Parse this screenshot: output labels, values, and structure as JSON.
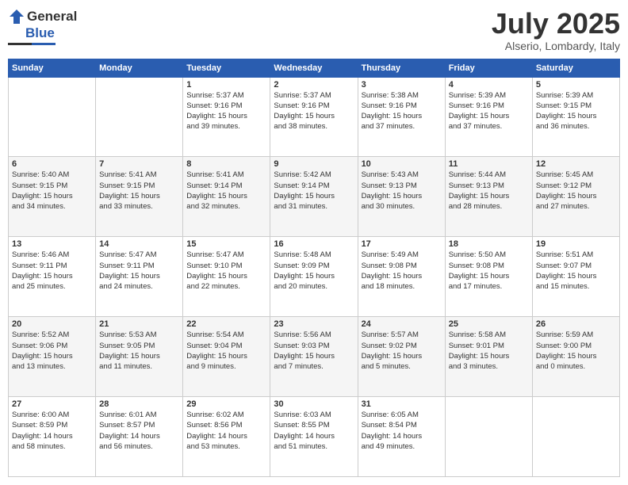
{
  "logo": {
    "general": "General",
    "blue": "Blue"
  },
  "title": "July 2025",
  "location": "Alserio, Lombardy, Italy",
  "headers": [
    "Sunday",
    "Monday",
    "Tuesday",
    "Wednesday",
    "Thursday",
    "Friday",
    "Saturday"
  ],
  "weeks": [
    [
      {
        "day": "",
        "info": ""
      },
      {
        "day": "",
        "info": ""
      },
      {
        "day": "1",
        "info": "Sunrise: 5:37 AM\nSunset: 9:16 PM\nDaylight: 15 hours\nand 39 minutes."
      },
      {
        "day": "2",
        "info": "Sunrise: 5:37 AM\nSunset: 9:16 PM\nDaylight: 15 hours\nand 38 minutes."
      },
      {
        "day": "3",
        "info": "Sunrise: 5:38 AM\nSunset: 9:16 PM\nDaylight: 15 hours\nand 37 minutes."
      },
      {
        "day": "4",
        "info": "Sunrise: 5:39 AM\nSunset: 9:16 PM\nDaylight: 15 hours\nand 37 minutes."
      },
      {
        "day": "5",
        "info": "Sunrise: 5:39 AM\nSunset: 9:15 PM\nDaylight: 15 hours\nand 36 minutes."
      }
    ],
    [
      {
        "day": "6",
        "info": "Sunrise: 5:40 AM\nSunset: 9:15 PM\nDaylight: 15 hours\nand 34 minutes."
      },
      {
        "day": "7",
        "info": "Sunrise: 5:41 AM\nSunset: 9:15 PM\nDaylight: 15 hours\nand 33 minutes."
      },
      {
        "day": "8",
        "info": "Sunrise: 5:41 AM\nSunset: 9:14 PM\nDaylight: 15 hours\nand 32 minutes."
      },
      {
        "day": "9",
        "info": "Sunrise: 5:42 AM\nSunset: 9:14 PM\nDaylight: 15 hours\nand 31 minutes."
      },
      {
        "day": "10",
        "info": "Sunrise: 5:43 AM\nSunset: 9:13 PM\nDaylight: 15 hours\nand 30 minutes."
      },
      {
        "day": "11",
        "info": "Sunrise: 5:44 AM\nSunset: 9:13 PM\nDaylight: 15 hours\nand 28 minutes."
      },
      {
        "day": "12",
        "info": "Sunrise: 5:45 AM\nSunset: 9:12 PM\nDaylight: 15 hours\nand 27 minutes."
      }
    ],
    [
      {
        "day": "13",
        "info": "Sunrise: 5:46 AM\nSunset: 9:11 PM\nDaylight: 15 hours\nand 25 minutes."
      },
      {
        "day": "14",
        "info": "Sunrise: 5:47 AM\nSunset: 9:11 PM\nDaylight: 15 hours\nand 24 minutes."
      },
      {
        "day": "15",
        "info": "Sunrise: 5:47 AM\nSunset: 9:10 PM\nDaylight: 15 hours\nand 22 minutes."
      },
      {
        "day": "16",
        "info": "Sunrise: 5:48 AM\nSunset: 9:09 PM\nDaylight: 15 hours\nand 20 minutes."
      },
      {
        "day": "17",
        "info": "Sunrise: 5:49 AM\nSunset: 9:08 PM\nDaylight: 15 hours\nand 18 minutes."
      },
      {
        "day": "18",
        "info": "Sunrise: 5:50 AM\nSunset: 9:08 PM\nDaylight: 15 hours\nand 17 minutes."
      },
      {
        "day": "19",
        "info": "Sunrise: 5:51 AM\nSunset: 9:07 PM\nDaylight: 15 hours\nand 15 minutes."
      }
    ],
    [
      {
        "day": "20",
        "info": "Sunrise: 5:52 AM\nSunset: 9:06 PM\nDaylight: 15 hours\nand 13 minutes."
      },
      {
        "day": "21",
        "info": "Sunrise: 5:53 AM\nSunset: 9:05 PM\nDaylight: 15 hours\nand 11 minutes."
      },
      {
        "day": "22",
        "info": "Sunrise: 5:54 AM\nSunset: 9:04 PM\nDaylight: 15 hours\nand 9 minutes."
      },
      {
        "day": "23",
        "info": "Sunrise: 5:56 AM\nSunset: 9:03 PM\nDaylight: 15 hours\nand 7 minutes."
      },
      {
        "day": "24",
        "info": "Sunrise: 5:57 AM\nSunset: 9:02 PM\nDaylight: 15 hours\nand 5 minutes."
      },
      {
        "day": "25",
        "info": "Sunrise: 5:58 AM\nSunset: 9:01 PM\nDaylight: 15 hours\nand 3 minutes."
      },
      {
        "day": "26",
        "info": "Sunrise: 5:59 AM\nSunset: 9:00 PM\nDaylight: 15 hours\nand 0 minutes."
      }
    ],
    [
      {
        "day": "27",
        "info": "Sunrise: 6:00 AM\nSunset: 8:59 PM\nDaylight: 14 hours\nand 58 minutes."
      },
      {
        "day": "28",
        "info": "Sunrise: 6:01 AM\nSunset: 8:57 PM\nDaylight: 14 hours\nand 56 minutes."
      },
      {
        "day": "29",
        "info": "Sunrise: 6:02 AM\nSunset: 8:56 PM\nDaylight: 14 hours\nand 53 minutes."
      },
      {
        "day": "30",
        "info": "Sunrise: 6:03 AM\nSunset: 8:55 PM\nDaylight: 14 hours\nand 51 minutes."
      },
      {
        "day": "31",
        "info": "Sunrise: 6:05 AM\nSunset: 8:54 PM\nDaylight: 14 hours\nand 49 minutes."
      },
      {
        "day": "",
        "info": ""
      },
      {
        "day": "",
        "info": ""
      }
    ]
  ]
}
